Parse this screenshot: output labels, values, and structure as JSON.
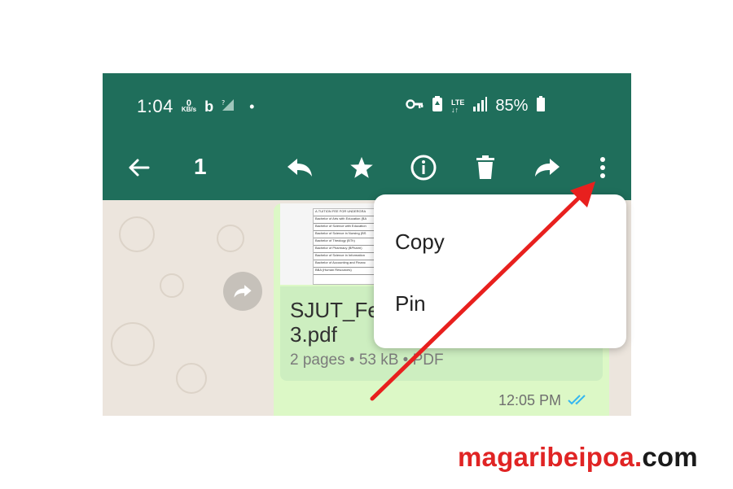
{
  "status_bar": {
    "time": "1:04",
    "data_speed_value": "0",
    "data_speed_unit": "KB/s",
    "bing_icon_label": "b",
    "network_type": "LTE",
    "battery_percent": "85%"
  },
  "action_bar": {
    "selected_count": "1"
  },
  "message": {
    "document": {
      "name_line1": "SJUT_Fe",
      "name_line2": "3.pdf",
      "meta": "2 pages • 53 kB • PDF",
      "preview_rows": [
        "A.TUITION FEE FOR UNDERGRA",
        "Bachelor of Arts with Education (BA",
        "Bachelor of Science with Education",
        "Bachelor of Science in Nursing (BS",
        "Bachelor of Theology (BTh)",
        "Bachelor of Pharmacy (BPharm)",
        "Bachelor of Science in Information",
        "Bachelor of Accounting and Financ",
        "BBA (Human Resources)"
      ]
    },
    "time": "12:05 PM"
  },
  "context_menu": {
    "items": [
      {
        "label": "Copy"
      },
      {
        "label": "Pin"
      }
    ]
  },
  "brand": {
    "part1": "magaribeipoa.",
    "part2": "com"
  },
  "colors": {
    "header": "#1f6e5b",
    "bubble": "#dcf8c6",
    "annotation_arrow": "#e8201e",
    "read_ticks": "#34b7f1"
  }
}
